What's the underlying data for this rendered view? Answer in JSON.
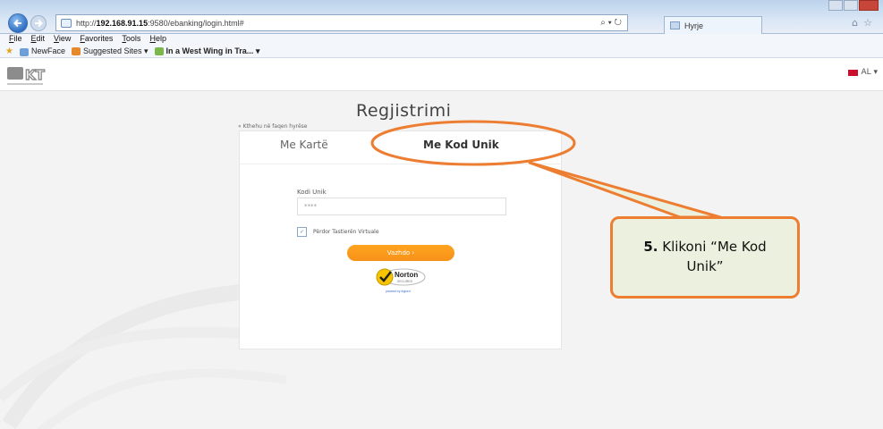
{
  "browser": {
    "url_prefix": "http://",
    "url_host": "192.168.91.15",
    "url_rest": ":9580/ebanking/login.html#",
    "search_controls": "⌕ ▾ ↻",
    "tab_title": "Hyrje"
  },
  "menu": [
    "File",
    "Edit",
    "View",
    "Favorites",
    "Tools",
    "Help"
  ],
  "favorites": {
    "newface": "NewFace",
    "suggested": "Suggested Sites ▾",
    "westwing": "In a West Wing in Tra... ▾"
  },
  "site": {
    "language": "AL ▾",
    "title": "Regjistrimi",
    "back_link": "« Kthehu në faqen hyrëse",
    "tabs": {
      "card": "Me Kartë",
      "code": "Me Kod Unik"
    },
    "field_label": "Kodi Unik",
    "field_value": "****",
    "checkbox_label": "Përdor Tastierën Virtuale",
    "continue_button": "Vazhdo ›",
    "norton_text": "Norton",
    "norton_sub": "SECURED",
    "norton_powered": "powered by digicert"
  },
  "callout": {
    "step": "5.",
    "text": "Klikoni “Me Kod Unik”"
  },
  "colors": {
    "accent_orange": "#ed7d31",
    "button_orange": "#f7911a",
    "callout_fill": "#ebf1de"
  }
}
